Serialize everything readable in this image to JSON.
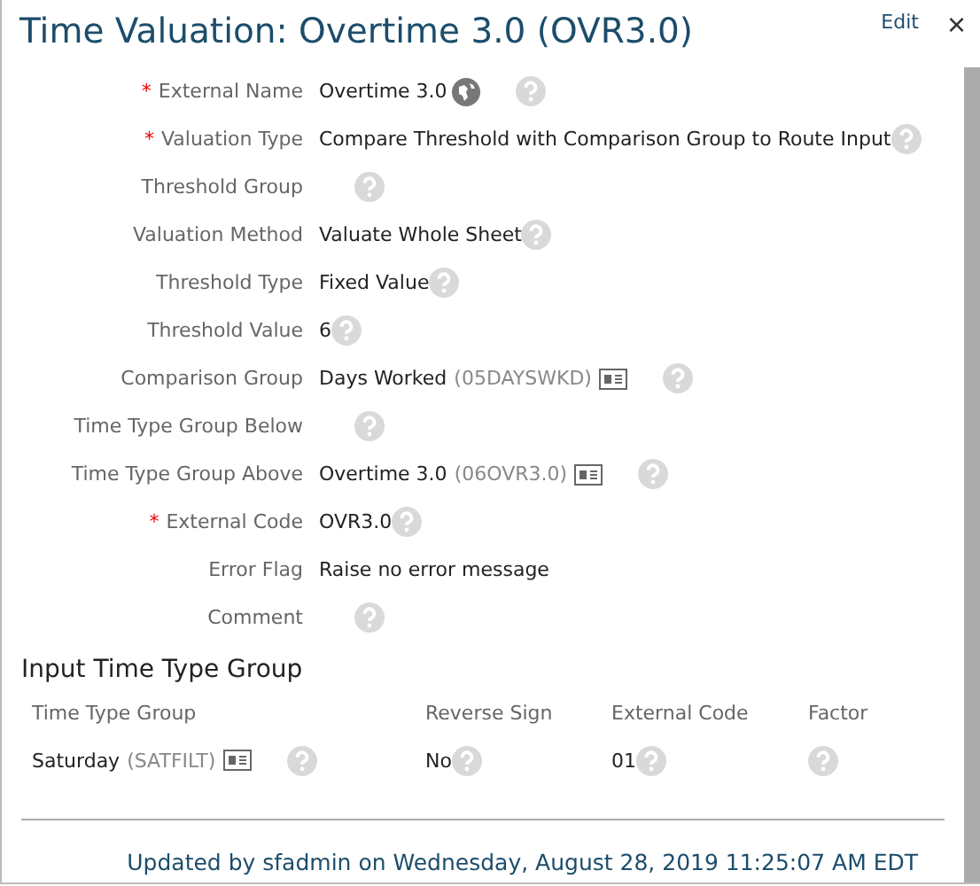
{
  "dialog": {
    "title": "Time Valuation: Overtime 3.0 (OVR3.0)",
    "edit_link": "Edit",
    "close": "×"
  },
  "fields": [
    {
      "label": "External Name",
      "required_mark": "*",
      "value": "Overtime 3.0",
      "globe": true,
      "help": true
    },
    {
      "label": "Valuation Type",
      "required_mark": "*",
      "value": "Compare Threshold with Comparison Group to Route Input",
      "help": true
    },
    {
      "label": "Threshold Group",
      "help": true
    },
    {
      "label": "Valuation Method",
      "value": "Valuate Whole Sheet",
      "help": true
    },
    {
      "label": "Threshold Type",
      "value": "Fixed Value",
      "help": true
    },
    {
      "label": "Threshold Value",
      "value": "6",
      "help": true
    },
    {
      "label": "Comparison Group",
      "value": "Days Worked",
      "code": "(05DAYSWKD)",
      "card": true,
      "help": true
    },
    {
      "label": "Time Type Group Below",
      "help": true
    },
    {
      "label": "Time Type Group Above",
      "value": "Overtime 3.0",
      "code": "(06OVR3.0)",
      "card": true,
      "help": true
    },
    {
      "label": "External Code",
      "required_mark": "*",
      "value": "OVR3.0",
      "help": true
    },
    {
      "label": "Error Flag",
      "value": "Raise no error message",
      "help": false
    },
    {
      "label": "Comment",
      "help": true
    }
  ],
  "section": {
    "title": "Input Time Type Group",
    "columns": [
      "Time Type Group",
      "Reverse Sign",
      "External Code",
      "Factor"
    ],
    "rows": [
      {
        "group": "Saturday",
        "group_code": "(SATFILT)",
        "reverse_sign": "No",
        "external_code": "01"
      }
    ]
  },
  "footer": "Updated by sfadmin on Wednesday, August 28, 2019 11:25:07 AM EDT"
}
